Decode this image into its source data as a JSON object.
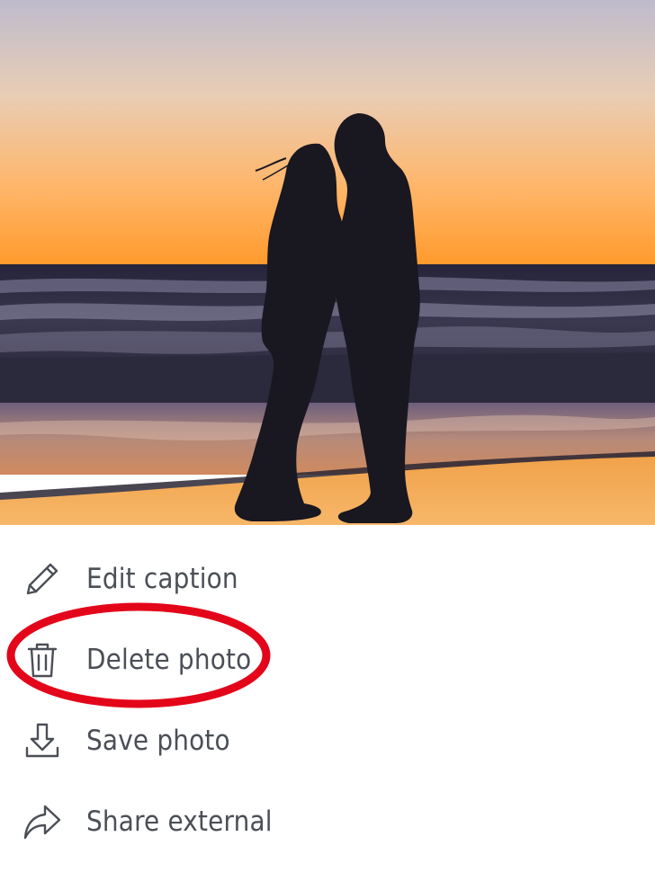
{
  "photo": {
    "subject": "couple-silhouette-kissing-beach-sunset"
  },
  "menu": {
    "items": [
      {
        "label": "Edit caption",
        "icon": "pencil-icon"
      },
      {
        "label": "Delete photo",
        "icon": "trash-icon"
      },
      {
        "label": "Save photo",
        "icon": "download-icon"
      },
      {
        "label": "Share external",
        "icon": "share-arrow-icon"
      }
    ]
  },
  "colors": {
    "menu_text": "#4b4f56",
    "icon_stroke": "#4b4f56",
    "highlight_ring": "#e3061a",
    "sky_top": "#c9c3cf",
    "sky_horizon": "#ff9f2f",
    "sea": "#2f2e42",
    "sand": "#f4a548"
  }
}
